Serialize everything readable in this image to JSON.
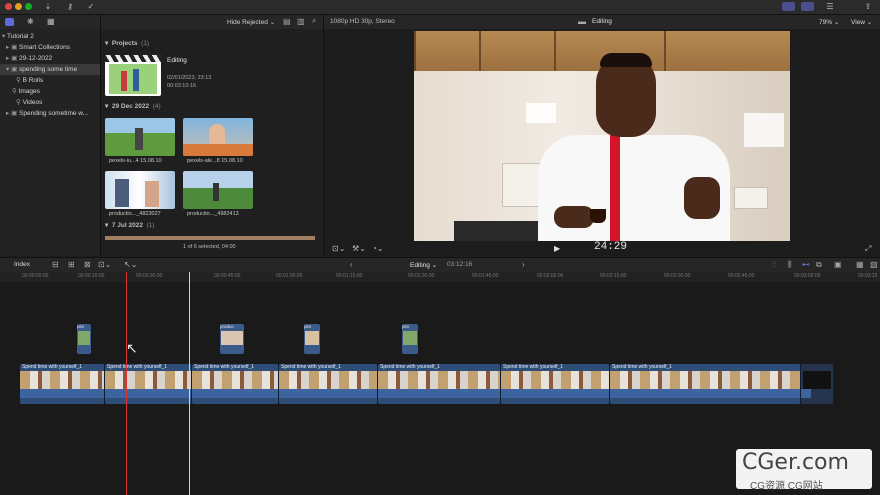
{
  "library": {
    "root": "Tutorial 2",
    "items": [
      {
        "label": "Smart Collections"
      },
      {
        "label": "29-12-2022"
      },
      {
        "label": "spending some time"
      },
      {
        "label": "B Rolls"
      },
      {
        "label": "Images"
      },
      {
        "label": "Videos"
      },
      {
        "label": "Spending sometime w..."
      }
    ]
  },
  "browser": {
    "filter": "Hide Rejected",
    "projects_label": "Projects",
    "projects_count": "(1)",
    "project": {
      "name": "Editing",
      "date": "02/01/2023, 23:13",
      "duration": "00:03:10:16"
    },
    "section2_label": "29 Dec 2022",
    "section2_count": "(4)",
    "clips": [
      {
        "caption": "pexels-iu...4 15.08.10"
      },
      {
        "caption": "pexels-ale...8 15.08.10"
      },
      {
        "caption": "productio..._4823027"
      },
      {
        "caption": "productio..._4982413"
      }
    ],
    "section3_label": "7 Jul 2022",
    "section3_count": "(1)",
    "status": "1 of 6 selected, 04:00"
  },
  "viewer": {
    "format": "1080p HD 30p, Stereo",
    "title": "Editing",
    "zoom": "79%",
    "view_label": "View",
    "timecode": "24:29"
  },
  "timeline": {
    "index_label": "Index",
    "project_name": "Editing",
    "duration": "03:12:16",
    "ruler": [
      "00:00:00:00",
      "00:00:15:00",
      "00:00:30:00",
      "00:00:45:00",
      "00:01:00:00",
      "00:01:15:00",
      "00:01:30:00",
      "00:01:45:00",
      "00:02:00:00",
      "00:02:15:00",
      "00:02:30:00",
      "00:02:45:00",
      "00:03:00:00",
      "00:03:15"
    ],
    "connected": [
      {
        "label": "pex"
      },
      {
        "label": "produc"
      },
      {
        "label": "pex"
      },
      {
        "label": "pex"
      }
    ],
    "clip_label": "Spend time with yourself_1",
    "clip_label_short": "Spend time with yourself_1"
  },
  "watermark": {
    "main": "CGer.com",
    "sub": "CG资源 CG网站"
  }
}
